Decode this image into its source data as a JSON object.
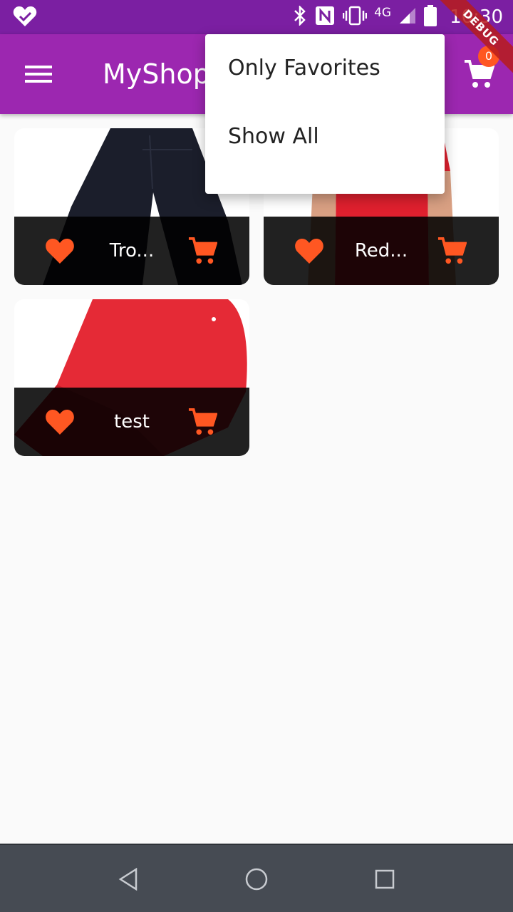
{
  "app": {
    "title": "MyShop",
    "cart_count": "0",
    "debug_label": "DEBUG",
    "accent": "#9c27b0",
    "status_color": "#7b1fa2",
    "secondary": "#ff5722"
  },
  "status_bar": {
    "time": "10:30",
    "network": "4G",
    "icons": [
      "heart-check-icon",
      "bluetooth-icon",
      "nfc-icon",
      "vibrate-icon",
      "signal-icon",
      "battery-icon"
    ]
  },
  "popup_menu": {
    "items": [
      {
        "label": "Only Favorites"
      },
      {
        "label": "Show All"
      }
    ]
  },
  "products": [
    {
      "title": "Tro...",
      "image": "dark trousers",
      "favorite": true
    },
    {
      "title": "Red...",
      "image": "red t-shirt",
      "favorite": true
    },
    {
      "title": "test",
      "image": "red cap",
      "favorite": true
    }
  ],
  "nav_bar": {
    "icons": [
      "back-icon",
      "home-icon",
      "recents-icon"
    ]
  }
}
